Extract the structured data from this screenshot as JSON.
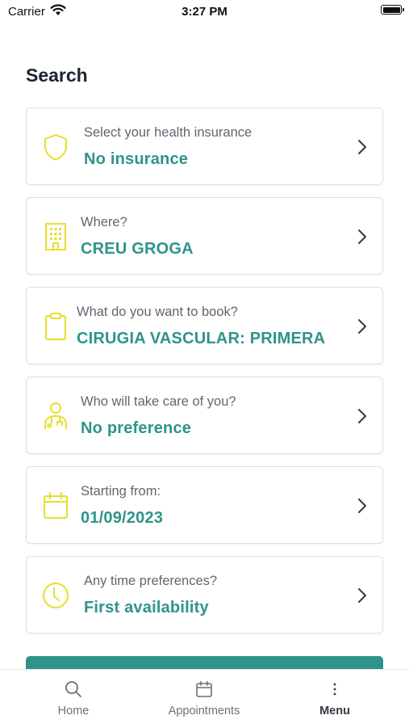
{
  "status_bar": {
    "carrier": "Carrier",
    "time": "3:27 PM"
  },
  "page": {
    "title": "Search"
  },
  "colors": {
    "accent": "#2e9489",
    "icon_yellow": "#e6df2a"
  },
  "cards": [
    {
      "icon": "shield-icon",
      "label": "Select your health insurance",
      "value": "No insurance"
    },
    {
      "icon": "building-icon",
      "label": "Where?",
      "value": "CREU GROGA"
    },
    {
      "icon": "clipboard-icon",
      "label": "What do you want to book?",
      "value": "CIRUGIA VASCULAR: PRIMERA"
    },
    {
      "icon": "doctor-icon",
      "label": "Who will take care of you?",
      "value": "No preference"
    },
    {
      "icon": "calendar-icon",
      "label": "Starting from:",
      "value": "01/09/2023"
    },
    {
      "icon": "clock-icon",
      "label": "Any time preferences?",
      "value": "First availability"
    }
  ],
  "tab_bar": {
    "items": [
      {
        "icon": "search-icon",
        "label": "Home"
      },
      {
        "icon": "calendar-icon",
        "label": "Appointments"
      },
      {
        "icon": "more-vertical-icon",
        "label": "Menu",
        "active": true
      }
    ]
  }
}
